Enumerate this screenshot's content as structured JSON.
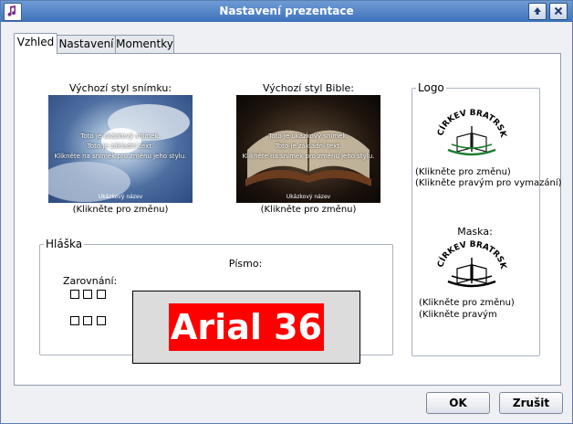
{
  "window": {
    "title": "Nastavení prezentace"
  },
  "tabs": [
    {
      "label": "Vzhled",
      "active": true
    },
    {
      "label": "Nastavení"
    },
    {
      "label": "Momentky"
    }
  ],
  "default_slide": {
    "heading": "Výchozí styl snímku:",
    "lines": [
      "Toto je ukázkový snímek.",
      "Toto je základní text.",
      "Klikněte na snímek pro změnu jeho stylu."
    ],
    "name": "Ukázkový název",
    "caption": "(Klikněte pro změnu)"
  },
  "bible_style": {
    "heading": "Výchozí styl Bible:",
    "lines": [
      "Toto je ukázkový snímek.",
      "Toto je základní text.",
      "Klikněte na snímek pro změnu jeho stylu."
    ],
    "name": "Ukázkový název",
    "caption": "(Klikněte pro změnu)"
  },
  "logo": {
    "legend": "Logo",
    "caption_change": "(Klikněte pro změnu)",
    "caption_delete": "(Klikněte pravým pro vymazání)",
    "logo_text": "CÍRKEV BRATRSKÁ",
    "mask_heading": "Maska:",
    "mask_caption_change": "(Klikněte pro změnu)",
    "mask_caption_delete": "(Klikněte pravým pro vymazání)"
  },
  "hlaska": {
    "legend": "Hláška",
    "align_label": "Zarovnání:",
    "font_label": "Písmo:",
    "font_sample": "Arial 36",
    "sample_bg": "#ff0000"
  },
  "buttons": {
    "ok": "OK",
    "cancel": "Zrušit"
  },
  "colors": {
    "titlebar": "#4f7fc2",
    "accent": "#ff0000"
  }
}
